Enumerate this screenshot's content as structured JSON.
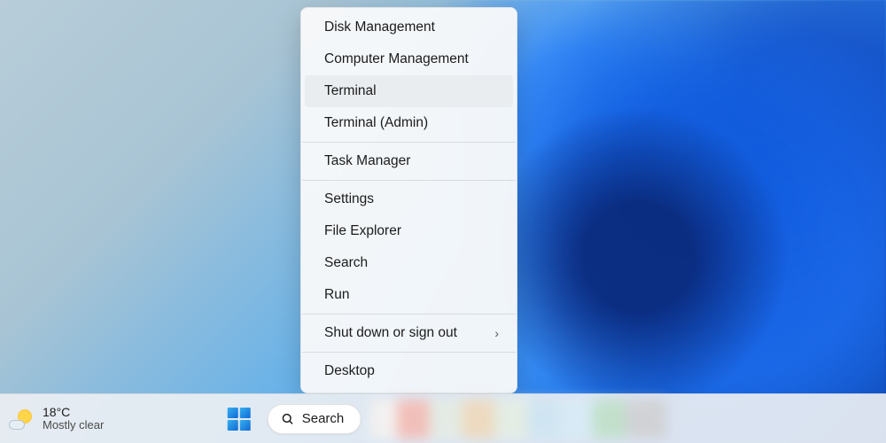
{
  "context_menu": {
    "items": [
      {
        "label": "Disk Management",
        "highlighted": false,
        "sep_after": false,
        "submenu": false
      },
      {
        "label": "Computer Management",
        "highlighted": false,
        "sep_after": false,
        "submenu": false
      },
      {
        "label": "Terminal",
        "highlighted": true,
        "sep_after": false,
        "submenu": false
      },
      {
        "label": "Terminal (Admin)",
        "highlighted": false,
        "sep_after": true,
        "submenu": false
      },
      {
        "label": "Task Manager",
        "highlighted": false,
        "sep_after": true,
        "submenu": false
      },
      {
        "label": "Settings",
        "highlighted": false,
        "sep_after": false,
        "submenu": false
      },
      {
        "label": "File Explorer",
        "highlighted": false,
        "sep_after": false,
        "submenu": false
      },
      {
        "label": "Search",
        "highlighted": false,
        "sep_after": false,
        "submenu": false
      },
      {
        "label": "Run",
        "highlighted": false,
        "sep_after": true,
        "submenu": false
      },
      {
        "label": "Shut down or sign out",
        "highlighted": false,
        "sep_after": true,
        "submenu": true
      },
      {
        "label": "Desktop",
        "highlighted": false,
        "sep_after": false,
        "submenu": false
      }
    ]
  },
  "taskbar": {
    "weather": {
      "temp": "18°C",
      "description": "Mostly clear"
    },
    "search_label": "Search"
  }
}
